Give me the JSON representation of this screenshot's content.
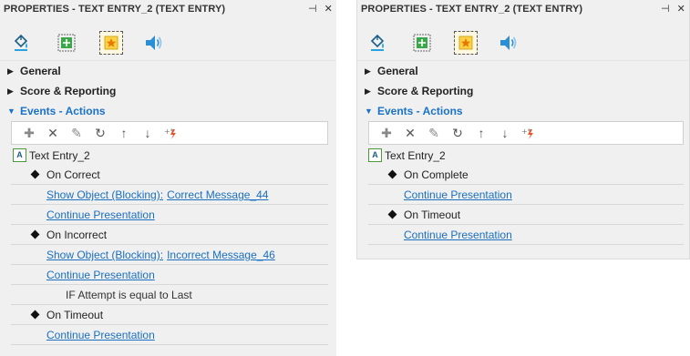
{
  "left_panel": {
    "title": "PROPERTIES - TEXT ENTRY_2 (TEXT ENTRY)",
    "pin_icon": "⊣",
    "close_icon": "✕",
    "sections": {
      "general": "General",
      "score": "Score & Reporting",
      "events": "Events - Actions"
    },
    "root_item": "Text Entry_2",
    "events": [
      {
        "name": "On Correct",
        "actions": [
          {
            "action": "Show Object (Blocking):",
            "target": "Correct Message_44"
          },
          {
            "action": "Continue Presentation",
            "target": ""
          }
        ]
      },
      {
        "name": "On Incorrect",
        "actions": [
          {
            "action": "Show Object (Blocking):",
            "target": "Incorrect Message_46"
          },
          {
            "action": "Continue Presentation",
            "target": ""
          }
        ],
        "condition": "IF Attempt is equal to Last"
      },
      {
        "name": "On Timeout",
        "actions": [
          {
            "action": "Continue Presentation",
            "target": ""
          }
        ]
      }
    ]
  },
  "right_panel": {
    "title": "PROPERTIES - TEXT ENTRY_2 (TEXT ENTRY)",
    "pin_icon": "⊣",
    "close_icon": "✕",
    "sections": {
      "general": "General",
      "score": "Score & Reporting",
      "events": "Events - Actions"
    },
    "root_item": "Text Entry_2",
    "events": [
      {
        "name": "On Complete",
        "actions": [
          {
            "action": "Continue Presentation",
            "target": ""
          }
        ]
      },
      {
        "name": "On Timeout",
        "actions": [
          {
            "action": "Continue Presentation",
            "target": ""
          }
        ]
      }
    ]
  },
  "icons": {
    "tab_fill": "paint-bucket-icon",
    "tab_position": "position-size-icon",
    "tab_interaction": "star-interaction-icon",
    "tab_audio": "speaker-icon",
    "toolbar": [
      "add-icon",
      "delete-icon",
      "edit-icon",
      "undo-icon",
      "move-up-icon",
      "move-down-icon",
      "effects-icon"
    ],
    "root": "text-entry-icon",
    "root_glyph": "A"
  },
  "colors": {
    "panel_bg": "#f0f0f0",
    "link": "#1a6fbf",
    "section_expanded": "#1a73c7",
    "active_tab_bg": "#fff8e0"
  }
}
